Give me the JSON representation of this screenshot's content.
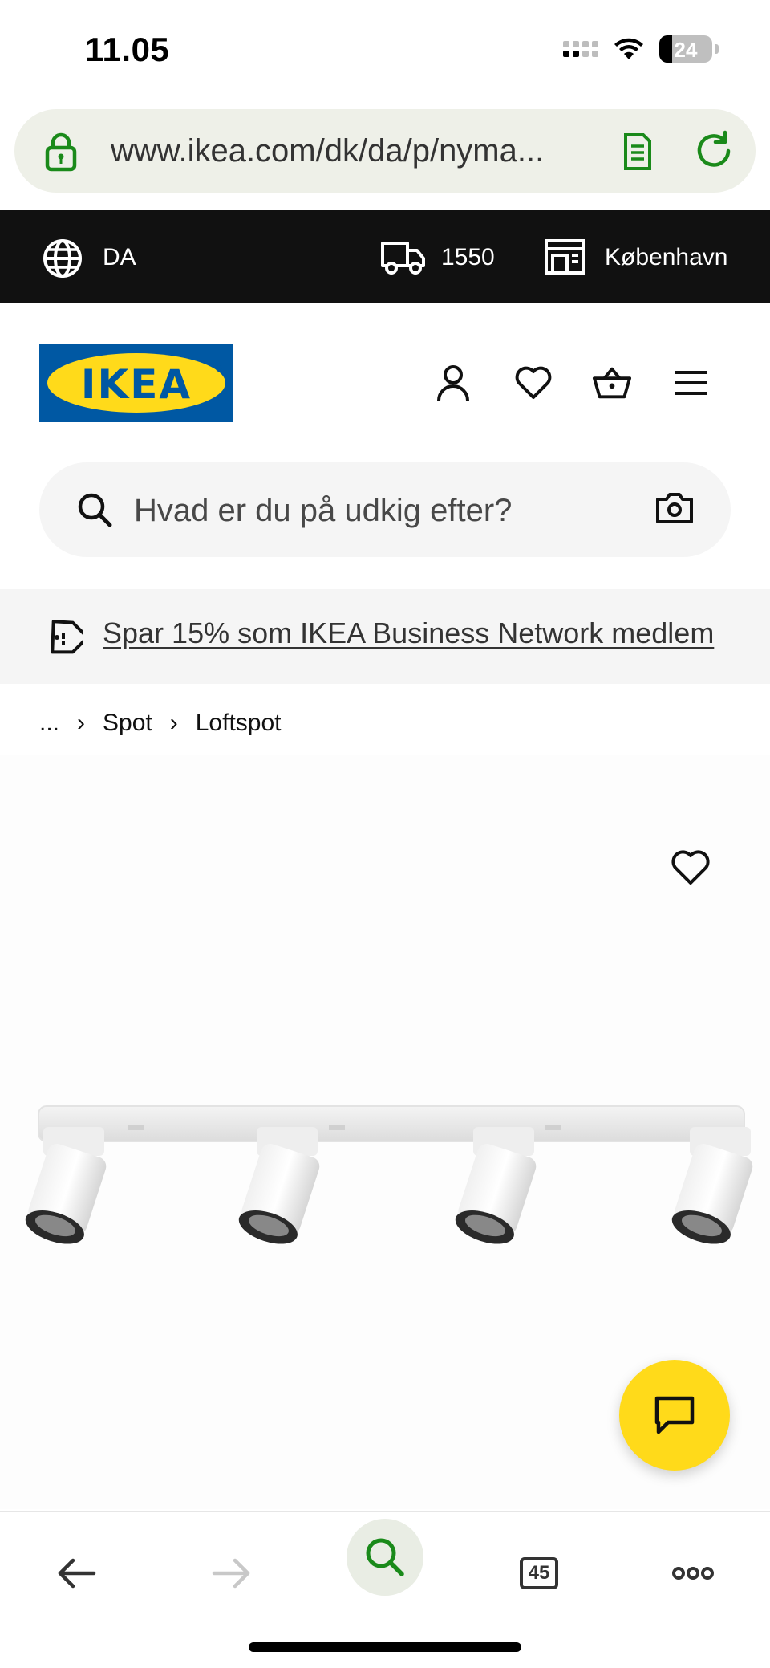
{
  "status_bar": {
    "time": "11.05",
    "battery": "24"
  },
  "browser": {
    "url": "www.ikea.com/dk/da/p/nyma..."
  },
  "topbar": {
    "language": "DA",
    "zip": "1550",
    "store": "København"
  },
  "header": {
    "logo_text": "IKEA",
    "logo_reg": "®"
  },
  "search": {
    "placeholder": "Hvad er du på udkig efter?"
  },
  "promo": {
    "text": "Spar 15% som IKEA Business Network medlem"
  },
  "breadcrumb": {
    "ellipsis": "...",
    "items": [
      "Spot",
      "Loftspot"
    ]
  },
  "toolbar": {
    "tab_count": "45"
  },
  "colors": {
    "ikea_blue": "#0058a3",
    "ikea_yellow": "#ffda1a",
    "browser_green": "#1a8a1a"
  },
  "icons": [
    "lock-icon",
    "reader-icon",
    "reload-icon",
    "globe-icon",
    "truck-icon",
    "store-icon",
    "account-icon",
    "heart-icon",
    "basket-icon",
    "menu-icon",
    "search-icon",
    "camera-icon",
    "tag-icon",
    "chat-icon",
    "back-icon",
    "forward-icon",
    "tabs-icon",
    "more-icon"
  ]
}
